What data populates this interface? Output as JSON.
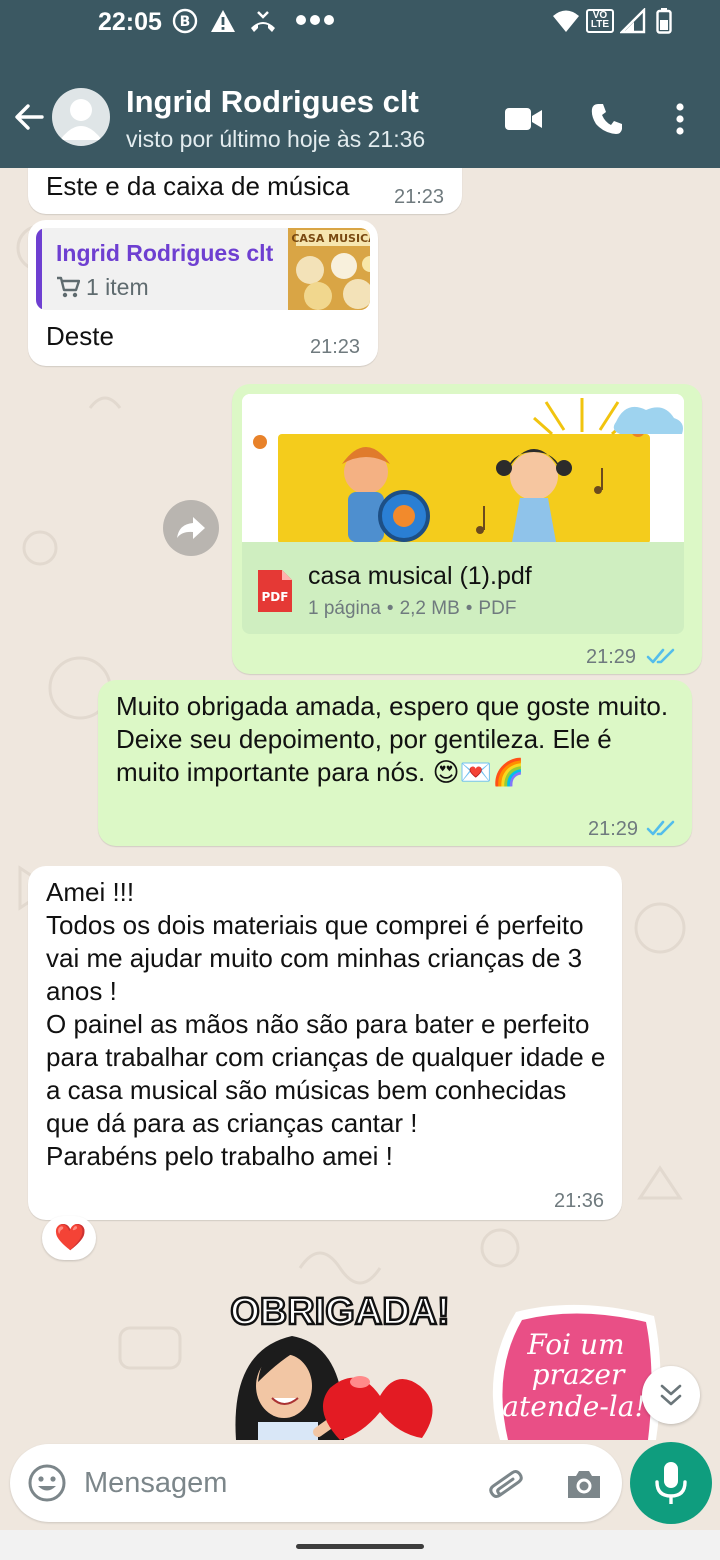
{
  "status_bar": {
    "time": "22:05",
    "network_badge": "VoLTE"
  },
  "header": {
    "contact_name": "Ingrid Rodrigues clt",
    "last_seen": "visto por último hoje às 21:36"
  },
  "messages": [
    {
      "id": "m1",
      "direction": "in",
      "text": "Este e da caixa de música",
      "time": "21:23"
    },
    {
      "id": "m2",
      "direction": "in",
      "quote": {
        "name": "Ingrid Rodrigues clt",
        "item": "1 item",
        "thumb_text": "CASA MUSICA"
      },
      "text": "Deste",
      "time": "21:23"
    },
    {
      "id": "m3",
      "direction": "out",
      "document": {
        "name": "casa musical (1).pdf",
        "pages": "1 página",
        "size": "2,2 MB",
        "type": "PDF",
        "icon_label": "PDF"
      },
      "time": "21:29",
      "status": "read"
    },
    {
      "id": "m4",
      "direction": "out",
      "text": "Muito obrigada amada, espero que goste muito. Deixe seu depoimento, por gentileza. Ele é muito importante para nós. 😍💌🌈",
      "time": "21:29",
      "status": "read"
    },
    {
      "id": "m5",
      "direction": "in",
      "text": "Amei !!!\nTodos os dois materiais que comprei é perfeito vai me ajudar muito com minhas crianças de 3 anos !\nO painel as mãos não são para bater e perfeito para trabalhar com crianças de qualquer idade e a casa musical são músicas bem conhecidas que dá para as crianças cantar !\nParabéns pelo trabalho amei !",
      "time": "21:36",
      "reaction": "❤️"
    }
  ],
  "stickers": [
    {
      "text": "OBRIGADA!"
    },
    {
      "lines": [
        "Foi um",
        "prazer",
        "atende-la!"
      ]
    }
  ],
  "composer": {
    "placeholder": "Mensagem"
  },
  "colors": {
    "header": "#3b5862",
    "outgoing_bubble": "#dcf8c6",
    "incoming_bubble": "#ffffff",
    "chat_background": "#efe7de",
    "mic_button": "#0f9d7e",
    "read_ticks": "#53bdeb",
    "quote_accent": "#6e3fd1"
  }
}
